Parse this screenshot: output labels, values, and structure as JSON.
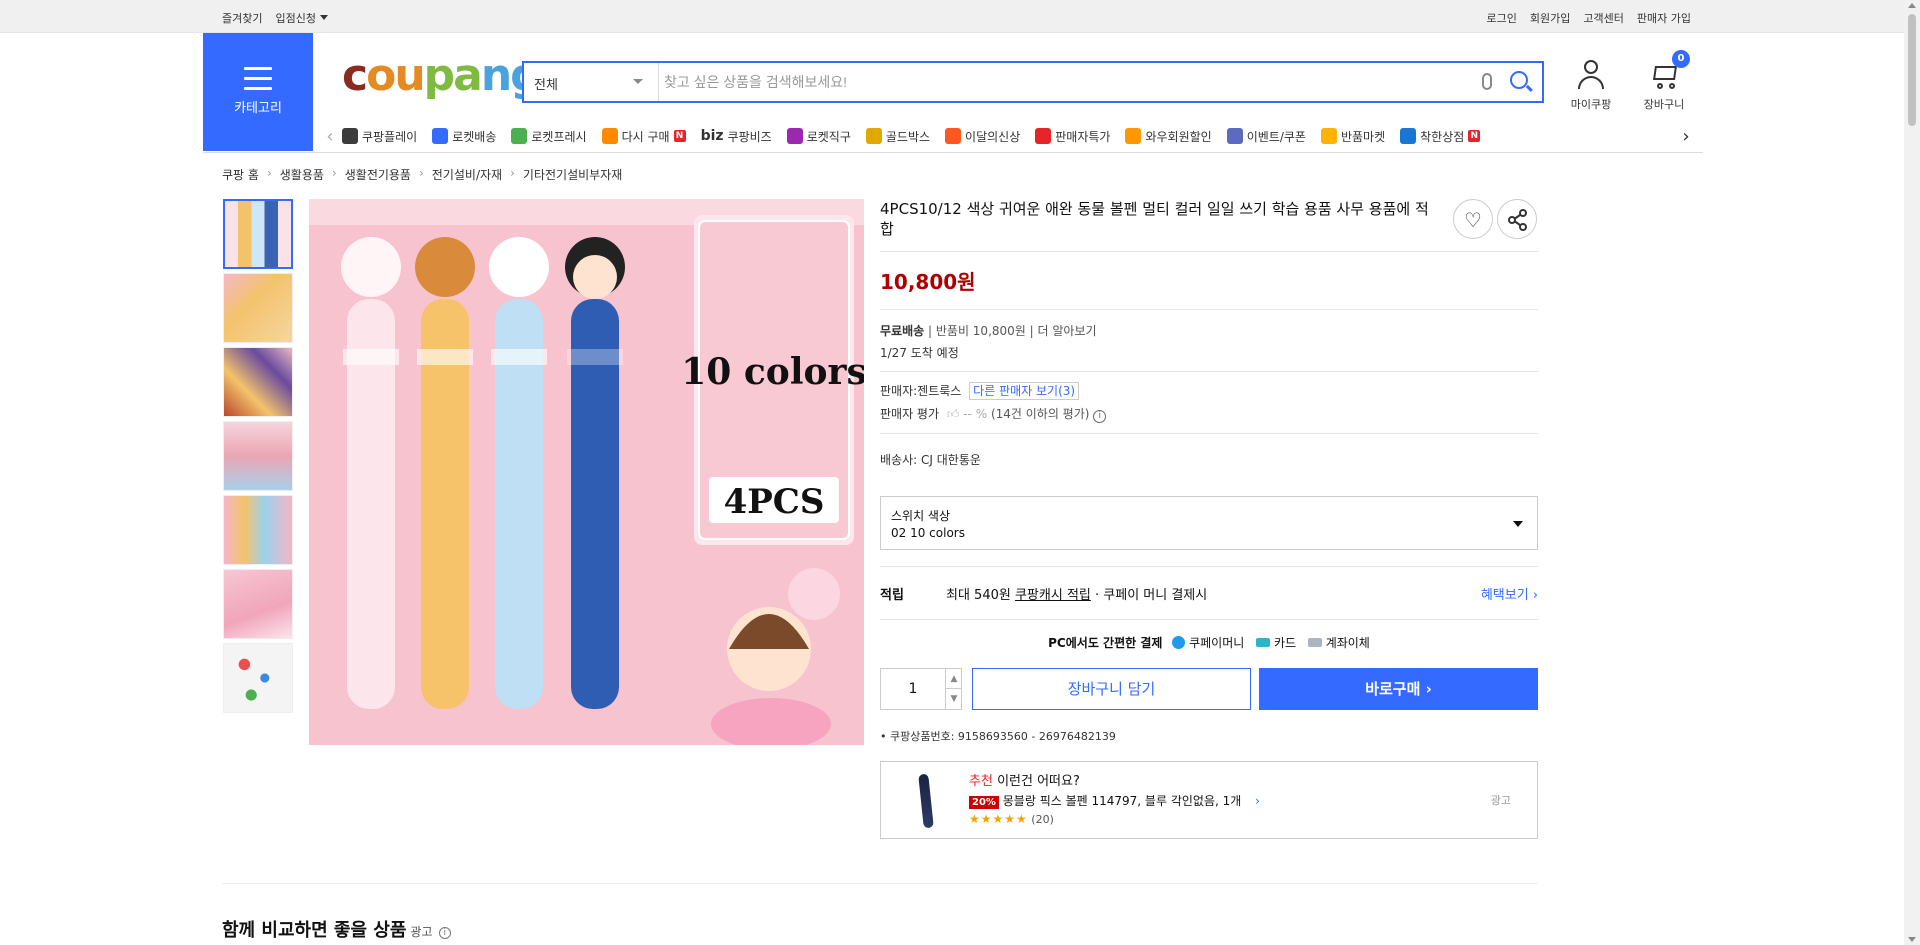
{
  "topbar": {
    "left": [
      "즐겨찾기",
      "입점신청"
    ],
    "right": [
      "로그인",
      "회원가입",
      "고객센터",
      "판매자 가입"
    ]
  },
  "header": {
    "category_label": "카테고리",
    "logo": {
      "c": "c",
      "o": "ou",
      "pa": "pa",
      "ng": "ng"
    },
    "search": {
      "category": "전체",
      "placeholder": "찾고 싶은 상품을 검색해보세요!"
    },
    "mycoupang": "마이쿠팡",
    "cart": {
      "label": "장바구니",
      "count": "0"
    }
  },
  "nav": {
    "items": [
      {
        "label": "쿠팡플레이",
        "color": "#3c3c3c",
        "badge": ""
      },
      {
        "label": "로켓배송",
        "color": "#346aff",
        "badge": ""
      },
      {
        "label": "로켓프레시",
        "color": "#4caf50",
        "badge": ""
      },
      {
        "label": "다시 구매",
        "color": "#ff8a00",
        "badge": "N"
      },
      {
        "label": "쿠팡비즈",
        "color": "#333333",
        "badge": "",
        "prefix": "biz"
      },
      {
        "label": "로켓직구",
        "color": "#9c27b0",
        "badge": ""
      },
      {
        "label": "골드박스",
        "color": "#e0a800",
        "badge": ""
      },
      {
        "label": "이달의신상",
        "color": "#ff5722",
        "badge": ""
      },
      {
        "label": "판매자특가",
        "color": "#e52528",
        "badge": ""
      },
      {
        "label": "와우회원할인",
        "color": "#ff9800",
        "badge": ""
      },
      {
        "label": "이벤트/쿠폰",
        "color": "#5c6bc0",
        "badge": ""
      },
      {
        "label": "반품마켓",
        "color": "#ffb300",
        "badge": ""
      },
      {
        "label": "착한상점",
        "color": "#1976d2",
        "badge": "N"
      }
    ]
  },
  "breadcrumb": [
    "쿠팡 홈",
    "생활용품",
    "생활전기용품",
    "전기설비/자재",
    "기타전기설비부자재"
  ],
  "product": {
    "title": "4PCS10/12 색상 귀여운 애완 동물 볼펜 멀티 컬러 일일 쓰기 학습 용품 사무 용품에 적합",
    "price": "10,800원",
    "shipping": {
      "free": "무료배송",
      "return_fee": "반품비 10,800원",
      "more": "더 알아보기",
      "arrival": "1/27 도착 예정"
    },
    "seller": {
      "label": "판매자:",
      "name": "젠트룩스",
      "other": "다른 판매자 보기(3)",
      "rating_label": "판매자 평가",
      "rating_value": "-- %",
      "rating_note": "(14건 이하의 평가)"
    },
    "carrier": {
      "label": "배송사:",
      "name": "CJ 대한통운"
    },
    "option": {
      "label": "스위치 색상",
      "value": "02 10 colors"
    },
    "reward": {
      "label": "적립",
      "text": "최대 540원",
      "cash": "쿠팡캐시 적립",
      "suffix": "· 쿠페이 머니 결제시",
      "benefit": "혜택보기"
    },
    "payment": {
      "label": "PC에서도 간편한 결제",
      "methods": [
        "쿠페이머니",
        "카드",
        "계좌이체"
      ]
    },
    "quantity": "1",
    "add_to_cart": "장바구니 담기",
    "buy_now": "바로구매",
    "product_no": "쿠팡상품번호: 9158693560 - 26976482139",
    "image_text": {
      "colors": "10 colors",
      "pcs": "4PCS"
    }
  },
  "recommend": {
    "tag": "추천",
    "title": "이런건 어떠요?",
    "discount": "20%",
    "name": "몽블랑 픽스 볼펜 114797, 블루 각인없음, 1개",
    "stars": "★★★★★",
    "reviews": "(20)",
    "ad": "광고"
  },
  "compare": {
    "title": "함께 비교하면 좋을 상품",
    "ad": "광고"
  }
}
